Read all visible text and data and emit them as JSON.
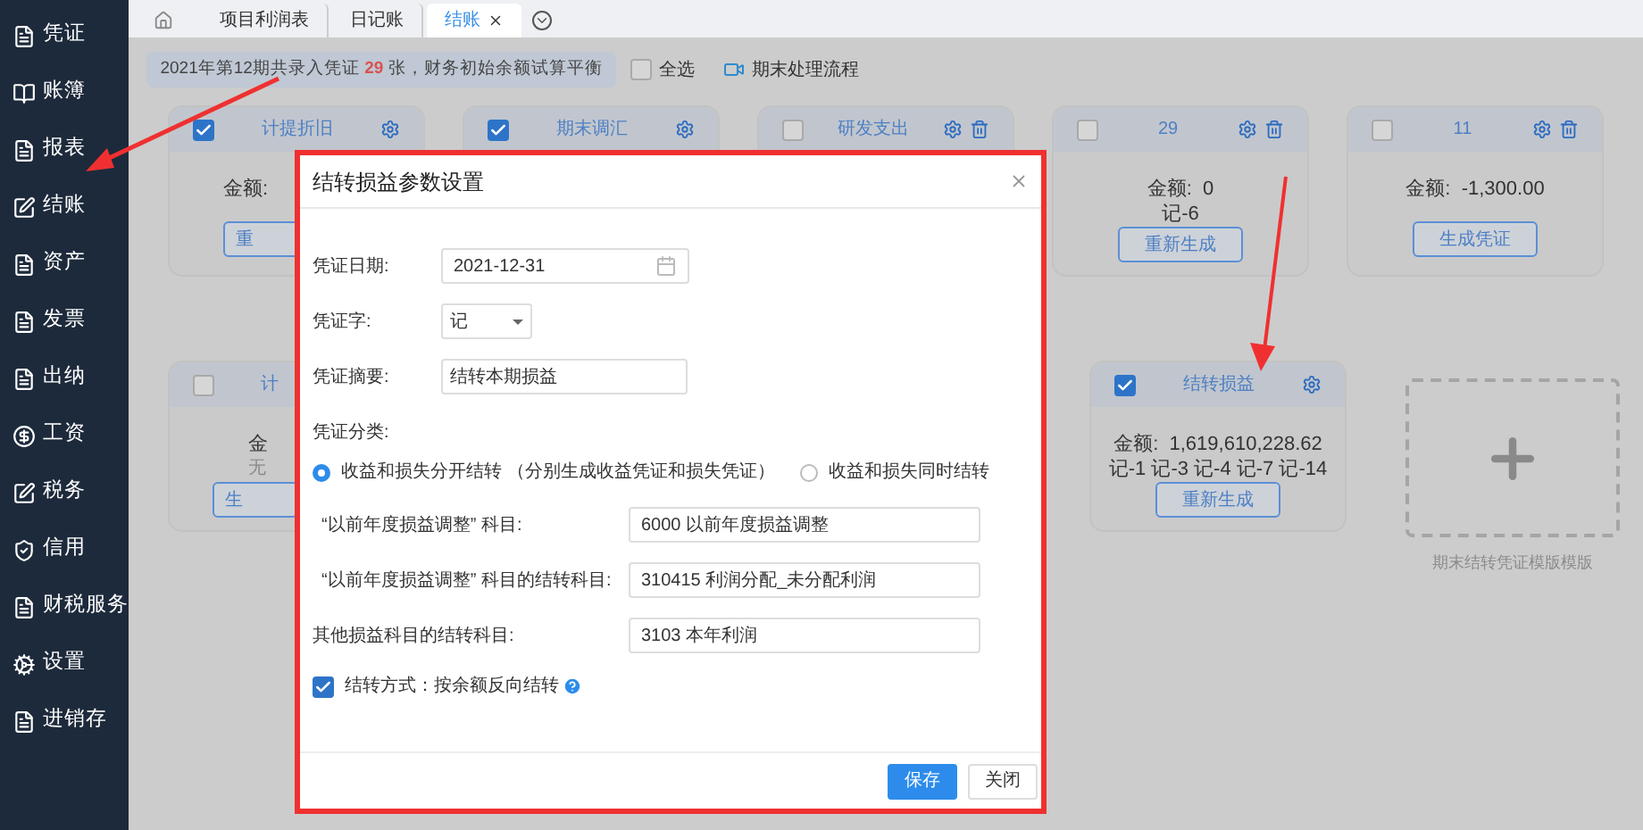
{
  "sidebar": {
    "items": [
      {
        "label": "凭证",
        "kind": "doc"
      },
      {
        "label": "账簿",
        "kind": "book"
      },
      {
        "label": "报表",
        "kind": "doc"
      },
      {
        "label": "结账",
        "kind": "edit"
      },
      {
        "label": "资产",
        "kind": "doc"
      },
      {
        "label": "发票",
        "kind": "doc"
      },
      {
        "label": "出纳",
        "kind": "doc"
      },
      {
        "label": "工资",
        "kind": "coin"
      },
      {
        "label": "税务",
        "kind": "edit"
      },
      {
        "label": "信用",
        "kind": "shield"
      },
      {
        "label": "财税服务",
        "kind": "doc"
      },
      {
        "label": "设置",
        "kind": "gear"
      },
      {
        "label": "进销存",
        "kind": "doc"
      }
    ]
  },
  "tabs": [
    {
      "label": "项目利润表",
      "selected": false
    },
    {
      "label": "日记账",
      "selected": false
    },
    {
      "label": "结账",
      "selected": true
    }
  ],
  "banner": {
    "prefix": "2021年第12期共录入凭证",
    "count": "29",
    "suffix": "张，财务初始余额试算平衡"
  },
  "select_all": {
    "label": "全选",
    "checked": false
  },
  "process_link": "期末处理流程",
  "cards": [
    {
      "title": "计提折旧",
      "checked": true,
      "trash": false,
      "amount": "金额:",
      "button": "重"
    },
    {
      "title": "期末调汇",
      "checked": true,
      "trash": false
    },
    {
      "title": "研发支出",
      "checked": false,
      "trash": true
    },
    {
      "title": "29",
      "checked": false,
      "trash": true,
      "amount": "金额:  0",
      "refs": "记-6",
      "button": "重新生成"
    },
    {
      "title": "11",
      "checked": false,
      "trash": true,
      "amount": "金额:  -1,300.00",
      "button": "生成凭证"
    },
    {
      "title": "计",
      "checked": false,
      "settings": false,
      "trash": false,
      "amount": "金",
      "note": "无",
      "button": "生"
    },
    {
      "title": "结转损益",
      "checked": true,
      "trash": false,
      "amount": "金额:  1,619,610,228.62",
      "refs": "记-1 记-3 记-4 记-7 记-14",
      "button": "重新生成"
    }
  ],
  "add_card": {
    "label": "期末结转凭证模版模版"
  },
  "dialog": {
    "title": "结转损益参数设置",
    "date": {
      "label": "凭证日期:",
      "value": "2021-12-31"
    },
    "word": {
      "label": "凭证字:",
      "value": "记"
    },
    "summary": {
      "label": "凭证摘要:",
      "value": "结转本期损益"
    },
    "category": {
      "label": "凭证分类:",
      "options": [
        {
          "label": "收益和损失分开结转 （分别生成收益凭证和损失凭证）",
          "selected": true
        },
        {
          "label": "收益和损失同时结转",
          "selected": false
        }
      ]
    },
    "accounts": [
      {
        "label": "“以前年度损益调整” 科目:",
        "value": "6000 以前年度损益调整"
      },
      {
        "label": "“以前年度损益调整” 科目的结转科目:",
        "value": "310415 利润分配_未分配利润"
      },
      {
        "label": "其他损益科目的结转科目:",
        "value": "3103 本年利润"
      }
    ],
    "method": {
      "label": "结转方式：按余额反向结转",
      "checked": true
    },
    "buttons": [
      {
        "label": "保存",
        "primary": true
      },
      {
        "label": "关闭",
        "primary": false
      }
    ]
  }
}
